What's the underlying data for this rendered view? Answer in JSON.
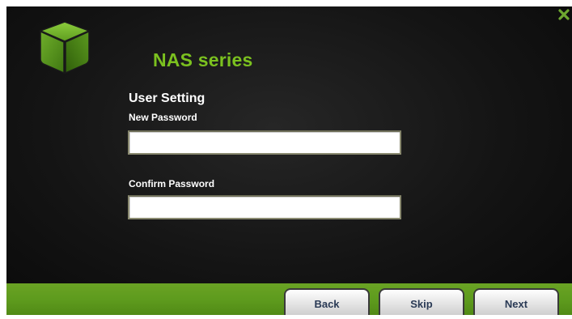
{
  "header": {
    "brand": "NAS series"
  },
  "form": {
    "section_title": "User Setting",
    "new_password": {
      "label": "New Password",
      "value": "",
      "placeholder": ""
    },
    "confirm_password": {
      "label": "Confirm Password",
      "value": "",
      "placeholder": ""
    }
  },
  "footer": {
    "back_label": "Back",
    "skip_label": "Skip",
    "next_label": "Next"
  },
  "icons": {
    "close": "close-icon",
    "logo": "cube-logo-icon"
  },
  "colors": {
    "accent": "#7bc11f",
    "footer": "#5d9a1d",
    "background": "#141414"
  }
}
